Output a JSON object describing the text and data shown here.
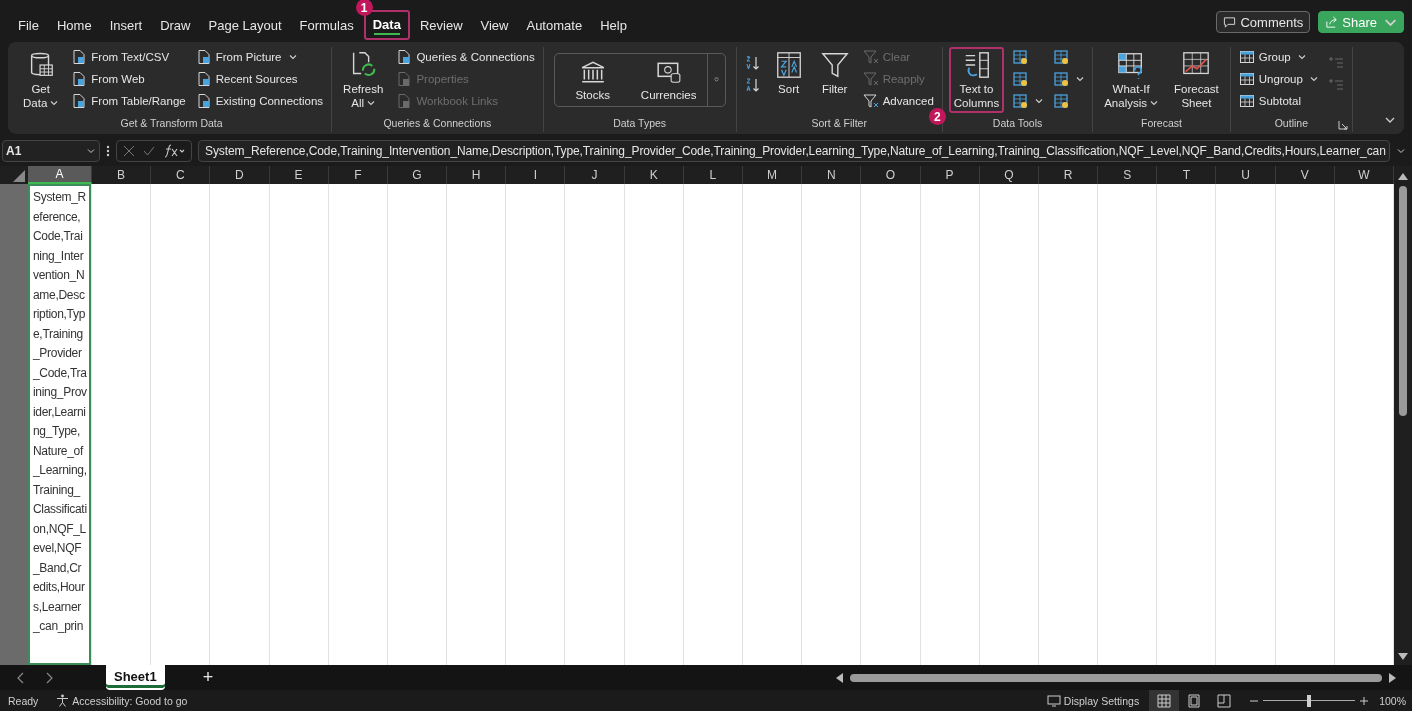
{
  "menu_tabs": [
    {
      "label": "File",
      "selected": false
    },
    {
      "label": "Home",
      "selected": false
    },
    {
      "label": "Insert",
      "selected": false
    },
    {
      "label": "Draw",
      "selected": false
    },
    {
      "label": "Page Layout",
      "selected": false
    },
    {
      "label": "Formulas",
      "selected": false
    },
    {
      "label": "Data",
      "selected": true,
      "callout": "1"
    },
    {
      "label": "Review",
      "selected": false
    },
    {
      "label": "View",
      "selected": false
    },
    {
      "label": "Automate",
      "selected": false
    },
    {
      "label": "Help",
      "selected": false
    }
  ],
  "header_buttons": [
    {
      "label": "Comments",
      "kind": "outline"
    },
    {
      "label": "Share",
      "kind": "primary"
    }
  ],
  "ribbon_groups": [
    {
      "label": "Get & Transform Data",
      "launcher": false,
      "items": [
        {
          "kind": "large",
          "lines": [
            "Get",
            "Data"
          ],
          "dropdown": true
        },
        {
          "kind": "stack",
          "items": [
            {
              "label": "From Text/CSV",
              "disabled": false,
              "dropdown": false
            },
            {
              "label": "From Web",
              "disabled": false,
              "dropdown": false
            },
            {
              "label": "From Table/Range",
              "disabled": false,
              "dropdown": false
            }
          ]
        },
        {
          "kind": "stack",
          "items": [
            {
              "label": "From Picture",
              "disabled": false,
              "dropdown": true
            },
            {
              "label": "Recent Sources",
              "disabled": false,
              "dropdown": false
            },
            {
              "label": "Existing Connections",
              "disabled": false,
              "dropdown": false
            }
          ]
        }
      ]
    },
    {
      "label": "Queries & Connections",
      "launcher": false,
      "items": [
        {
          "kind": "large",
          "lines": [
            "Refresh",
            "All"
          ],
          "dropdown": true
        },
        {
          "kind": "stack",
          "items": [
            {
              "label": "Queries & Connections",
              "disabled": false,
              "dropdown": false
            },
            {
              "label": "Properties",
              "disabled": true,
              "dropdown": false
            },
            {
              "label": "Workbook Links",
              "disabled": true,
              "dropdown": false
            }
          ]
        }
      ]
    },
    {
      "label": "Data Types",
      "launcher": false,
      "items": [
        {
          "kind": "gallery",
          "items": [
            {
              "label": "Stocks"
            },
            {
              "label": "Currencies"
            }
          ]
        }
      ]
    },
    {
      "label": "Sort & Filter",
      "launcher": false,
      "items": [
        {
          "kind": "stack",
          "items": [
            {
              "disabled": false,
              "dropdown": false
            },
            {
              "disabled": false,
              "dropdown": false
            }
          ]
        },
        {
          "kind": "large",
          "lines": [
            "Sort"
          ],
          "dropdown": false
        },
        {
          "kind": "large",
          "lines": [
            "Filter"
          ],
          "dropdown": false
        },
        {
          "kind": "stack",
          "items": [
            {
              "label": "Clear",
              "disabled": true,
              "dropdown": false
            },
            {
              "label": "Reapply",
              "disabled": true,
              "dropdown": false
            },
            {
              "label": "Advanced",
              "disabled": false,
              "dropdown": false
            }
          ]
        }
      ]
    },
    {
      "label": "Data Tools",
      "launcher": false,
      "items": [
        {
          "kind": "large",
          "lines": [
            "Text to",
            "Columns"
          ],
          "dropdown": false,
          "callout": "2"
        },
        {
          "kind": "stack",
          "items": [
            {
              "disabled": false,
              "dropdown": false
            },
            {
              "disabled": false,
              "dropdown": false
            },
            {
              "disabled": false,
              "dropdown": true
            }
          ]
        },
        {
          "kind": "stack",
          "items": [
            {
              "disabled": false,
              "dropdown": false
            },
            {
              "disabled": false,
              "dropdown": true
            },
            {
              "disabled": false,
              "dropdown": false
            }
          ]
        }
      ]
    },
    {
      "label": "Forecast",
      "launcher": false,
      "items": [
        {
          "kind": "large",
          "lines": [
            "What-If",
            "Analysis"
          ],
          "dropdown": true
        },
        {
          "kind": "large",
          "lines": [
            "Forecast",
            "Sheet"
          ],
          "dropdown": false
        }
      ]
    },
    {
      "label": "Outline",
      "launcher": true,
      "items": [
        {
          "kind": "stack",
          "items": [
            {
              "label": "Group",
              "disabled": false,
              "dropdown": true
            },
            {
              "label": "Ungroup",
              "disabled": false,
              "dropdown": true
            },
            {
              "label": "Subtotal",
              "disabled": false,
              "dropdown": false
            }
          ]
        },
        {
          "kind": "stack",
          "items": [
            {
              "disabled": true,
              "dropdown": false
            },
            {
              "disabled": true,
              "dropdown": false
            }
          ]
        }
      ]
    }
  ],
  "formula_bar": {
    "name_box": "A1",
    "formula": "System_Reference,Code,Training_Intervention_Name,Description,Type,Training_Provider_Code,Training_Provider,Learning_Type,Nature_of_Learning,Training_Classification,NQF_Level,NQF_Band,Credits,Hours,Learner_can"
  },
  "columns": [
    {
      "label": "A",
      "selected": true
    },
    {
      "label": "B",
      "selected": false
    },
    {
      "label": "C",
      "selected": false
    },
    {
      "label": "D",
      "selected": false
    },
    {
      "label": "E",
      "selected": false
    },
    {
      "label": "F",
      "selected": false
    },
    {
      "label": "G",
      "selected": false
    },
    {
      "label": "H",
      "selected": false
    },
    {
      "label": "I",
      "selected": false
    },
    {
      "label": "J",
      "selected": false
    },
    {
      "label": "K",
      "selected": false
    },
    {
      "label": "L",
      "selected": false
    },
    {
      "label": "M",
      "selected": false
    },
    {
      "label": "N",
      "selected": false
    },
    {
      "label": "O",
      "selected": false
    },
    {
      "label": "P",
      "selected": false
    },
    {
      "label": "Q",
      "selected": false
    },
    {
      "label": "R",
      "selected": false
    },
    {
      "label": "S",
      "selected": false
    },
    {
      "label": "T",
      "selected": false
    },
    {
      "label": "U",
      "selected": false
    },
    {
      "label": "V",
      "selected": false
    },
    {
      "label": "W",
      "selected": false
    }
  ],
  "cell_a1": "System_Reference,Code,Training_Intervention_Name,Description,Type,Training_Provider_Code,Training_Provider,Learning_Type,Nature_of_Learning,Training_Classification,NQF_Level,NQF_Band,Credits,Hours,Learner_can_prin",
  "sheet_tabs": [
    {
      "label": "Sheet1",
      "selected": true
    }
  ],
  "add_sheet": "+",
  "status_bar": {
    "ready": "Ready",
    "accessibility": "Accessibility: Good to go",
    "display_settings": "Display Settings",
    "views": [
      {
        "selected": true
      },
      {
        "selected": false
      },
      {
        "selected": false
      }
    ],
    "zoom": {
      "level": 0.5,
      "reading": "100%"
    }
  }
}
